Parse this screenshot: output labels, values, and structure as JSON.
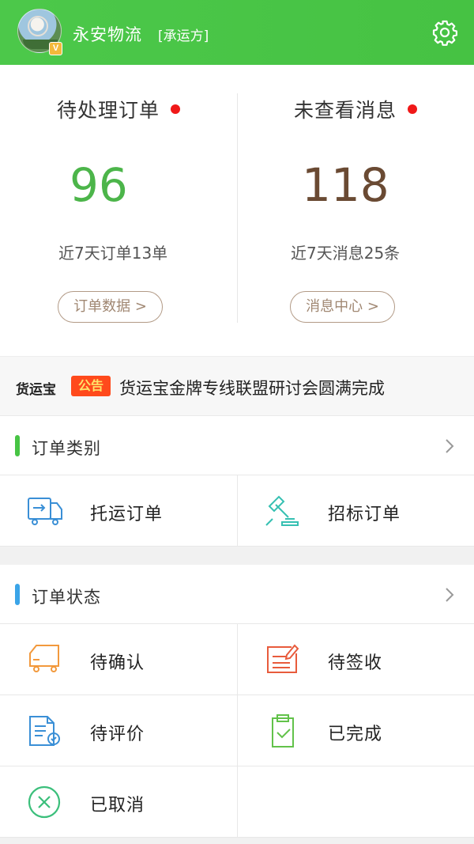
{
  "header": {
    "company": "永安物流",
    "role": "[承运方]",
    "badge": "V",
    "settings_icon": "gear-icon"
  },
  "stats": {
    "pending": {
      "title": "待处理订单",
      "value": "96",
      "sub": "近7天订单13单",
      "button": "订单数据 >",
      "color": "#4cb54a"
    },
    "messages": {
      "title": "未查看消息",
      "value": "118",
      "sub": "近7天消息25条",
      "button": "消息中心 >",
      "color": "#6a4a33"
    }
  },
  "notice": {
    "brand": "货运宝",
    "tag": "公告",
    "text": "货运宝金牌专线联盟研讨会圆满完成"
  },
  "order_category": {
    "title": "订单类别",
    "bar_color": "#47c444",
    "items": [
      {
        "label": "托运订单",
        "icon": "truck-icon"
      },
      {
        "label": "招标订单",
        "icon": "gavel-icon"
      }
    ]
  },
  "order_status": {
    "title": "订单状态",
    "bar_color": "#3aa4e8",
    "items": [
      {
        "label": "待确认",
        "icon": "delivery-truck-icon"
      },
      {
        "label": "待签收",
        "icon": "sign-form-icon"
      },
      {
        "label": "待评价",
        "icon": "review-document-icon"
      },
      {
        "label": "已完成",
        "icon": "clipboard-check-icon"
      },
      {
        "label": "已取消",
        "icon": "cancel-circle-icon"
      }
    ]
  }
}
